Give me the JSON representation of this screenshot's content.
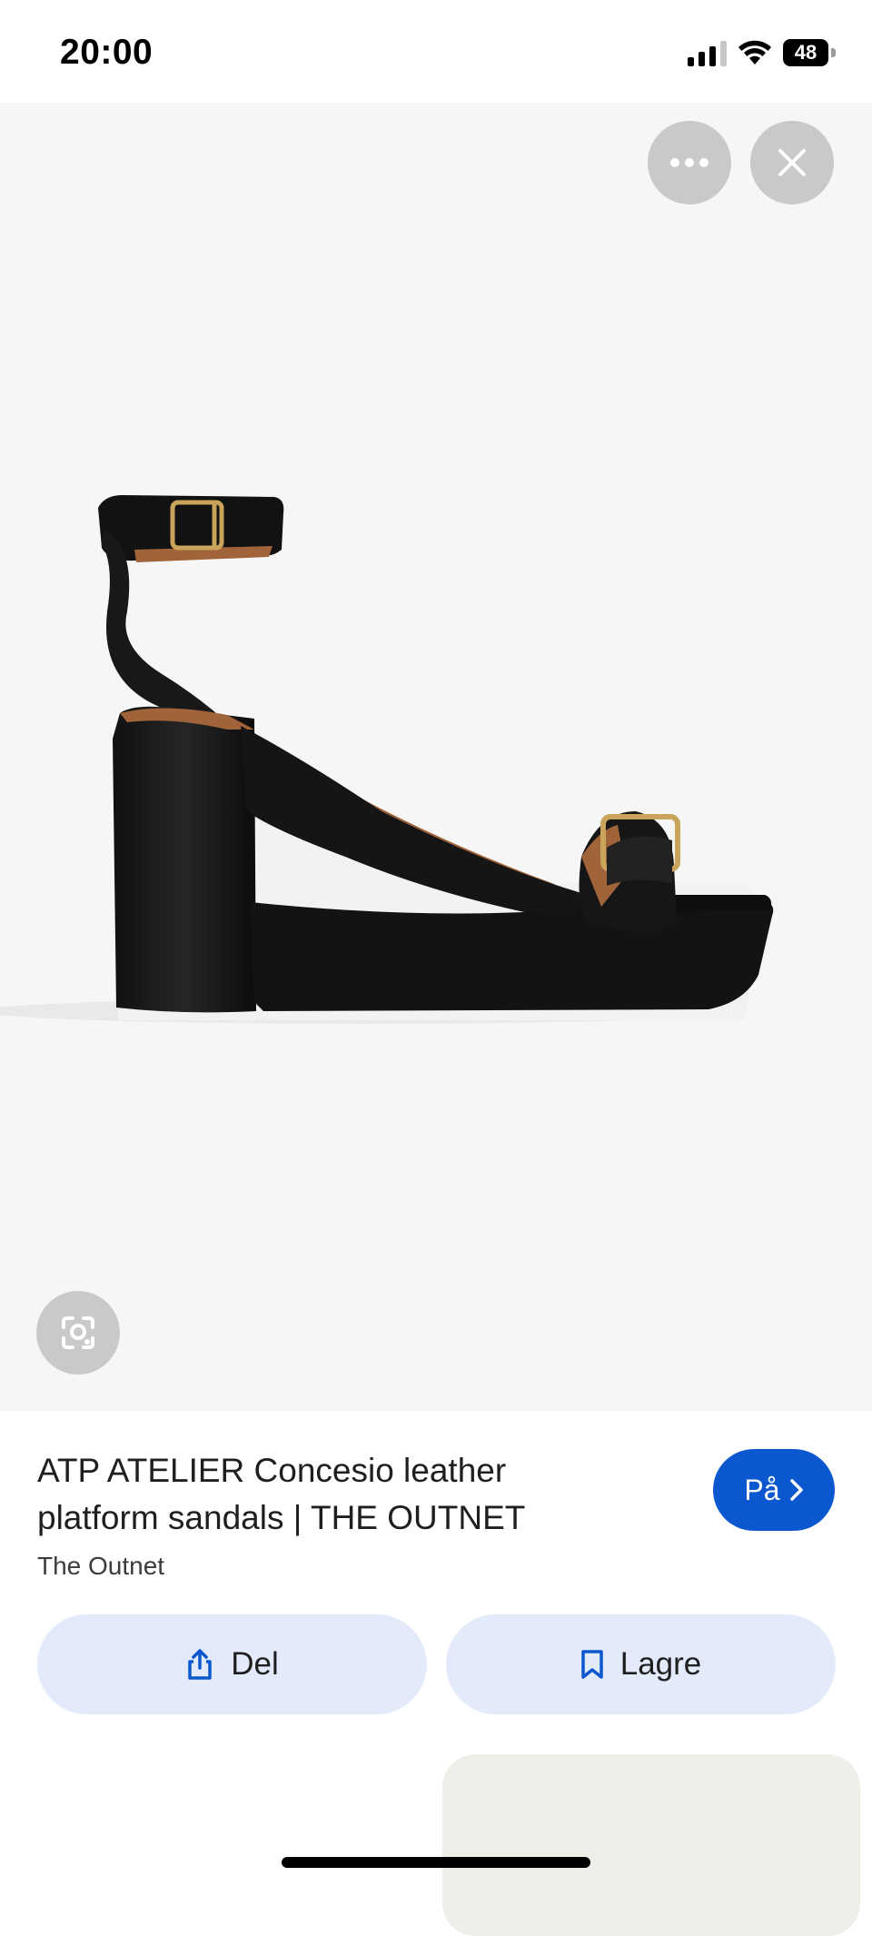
{
  "status": {
    "time": "20:00",
    "battery": "48"
  },
  "image": {
    "alt": "",
    "icons": {
      "more": "more-horizontal-icon",
      "close": "close-icon",
      "lens": "lens-search-icon"
    }
  },
  "product": {
    "title": "ATP ATELIER Concesio leather platform sandals | THE OUTNET",
    "source": "The Outnet",
    "visit_label": "På"
  },
  "actions": {
    "share_label": "Del",
    "save_label": "Lagre"
  },
  "colors": {
    "accent": "#0b57d0",
    "action_bg": "#e3ebfb",
    "image_bg": "#f6f6f6"
  }
}
